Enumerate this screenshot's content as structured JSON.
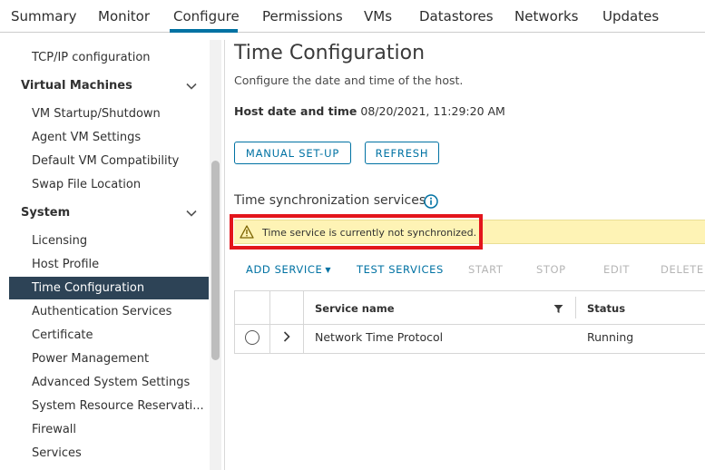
{
  "tabs": [
    {
      "label": "Summary"
    },
    {
      "label": "Monitor"
    },
    {
      "label": "Configure"
    },
    {
      "label": "Permissions"
    },
    {
      "label": "VMs"
    },
    {
      "label": "Datastores"
    },
    {
      "label": "Networks"
    },
    {
      "label": "Updates"
    }
  ],
  "active_tab": "Configure",
  "sidebar": {
    "top_item": "TCP/IP configuration",
    "groups": [
      {
        "title": "Virtual Machines",
        "items": [
          "VM Startup/Shutdown",
          "Agent VM Settings",
          "Default VM Compatibility",
          "Swap File Location"
        ]
      },
      {
        "title": "System",
        "items": [
          "Licensing",
          "Host Profile",
          "Time Configuration",
          "Authentication Services",
          "Certificate",
          "Power Management",
          "Advanced System Settings",
          "System Resource Reservati...",
          "Firewall",
          "Services"
        ]
      }
    ],
    "selected": "Time Configuration"
  },
  "main": {
    "title": "Time Configuration",
    "subtitle": "Configure the date and time of the host.",
    "host_datetime_label": "Host date and time",
    "host_datetime_value": "08/20/2021, 11:29:20 AM",
    "buttons": {
      "manual": "MANUAL SET-UP",
      "refresh": "REFRESH"
    },
    "sync_title": "Time synchronization services",
    "warning": "Time service is currently not synchronized.",
    "actions": {
      "add_service": "ADD SERVICE",
      "test_services": "TEST SERVICES",
      "start": "START",
      "stop": "STOP",
      "edit": "EDIT",
      "delete": "DELETE"
    },
    "table": {
      "columns": [
        "Service name",
        "Status"
      ],
      "rows": [
        {
          "service_name": "Network Time Protocol",
          "status": "Running"
        }
      ]
    }
  },
  "colors": {
    "accent": "#0072a3",
    "selected_bg": "#2d4356",
    "warning_bg": "#fef3b5",
    "highlight_box": "#e3151c"
  }
}
